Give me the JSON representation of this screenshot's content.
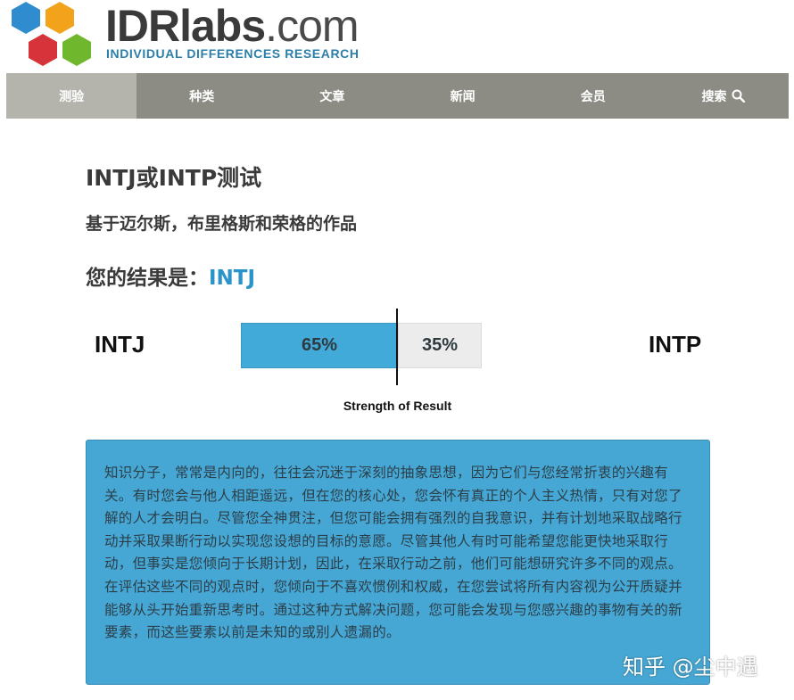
{
  "brand": {
    "name_bold": "IDRlabs",
    "name_light": ".com",
    "tagline": "INDIVIDUAL DIFFERENCES RESEARCH",
    "colors": {
      "hex_blue": "#2e8ccf",
      "hex_orange": "#f2a31b",
      "hex_red": "#d6343a",
      "hex_green": "#6fb72c",
      "tagline": "#2b7fa8"
    }
  },
  "nav": {
    "items": [
      {
        "label": "测验",
        "active": true
      },
      {
        "label": "种类"
      },
      {
        "label": "文章"
      },
      {
        "label": "新闻"
      },
      {
        "label": "会员"
      },
      {
        "label": "搜索",
        "icon": "search-icon"
      }
    ]
  },
  "test": {
    "title": "INTJ或INTP测试",
    "subtitle": "基于迈尔斯，布里格斯和荣格的作品",
    "result_prefix": "您的结果是：",
    "result_value": "INTJ"
  },
  "strength": {
    "left_label": "INTJ",
    "right_label": "INTP",
    "left_percent": "65%",
    "right_percent": "35%",
    "left_fraction": 0.65,
    "caption": "Strength of Result"
  },
  "description": "知识分子，常常是内向的，往往会沉迷于深刻的抽象思想，因为它们与您经常折衷的兴趣有关。有时您会与他人相距遥远，但在您的核心处，您会怀有真正的个人主义热情，只有对您了解的人才会明白。尽管您全神贯注，但您可能会拥有强烈的自我意识，并有计划地采取战略行动并采取果断行动以实现您设想的目标的意愿。尽管其他人有时可能希望您能更快地采取行动，但事实是您倾向于长期计划，因此，在采取行动之前，他们可能想研究许多不同的观点。在评估这些不同的观点时，您倾向于不喜欢惯例和权威，在您尝试将所有内容视为公开质疑并能够从头开始重新思考时。通过这种方式解决问题，您可能会发现与您感兴趣的事物有关的新要素，而这些要素以前是未知的或别人遗漏的。",
  "watermark": "知乎 @尘中遇"
}
